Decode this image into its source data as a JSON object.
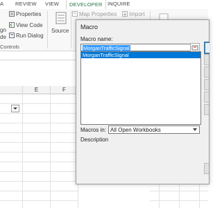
{
  "ribbon_tabs": [
    "A",
    "REVIEW",
    "VIEW",
    "DEVELOPER",
    "INQUIRE"
  ],
  "ribbon": {
    "partial_left_1": "gn",
    "partial_left_2": "de",
    "properties": "Properties",
    "view_code": "View Code",
    "run_dialog": "Run Dialog",
    "source": "Source",
    "map_properties": "Map Properties",
    "import": "Import",
    "controls_group": "Controls"
  },
  "columns": [
    "E",
    "F"
  ],
  "dialog": {
    "title": "Macro",
    "macro_name_label": "Macro name:",
    "macro_name_value": "MorganTrafficSignal",
    "list_items": [
      "MorganTrafficSignal"
    ],
    "macros_in_label": "Macros in:",
    "macros_in_value": "All Open Workbooks",
    "description_label": "Description"
  },
  "colors": {
    "accent": "#217346",
    "selection": "#0078d7"
  }
}
